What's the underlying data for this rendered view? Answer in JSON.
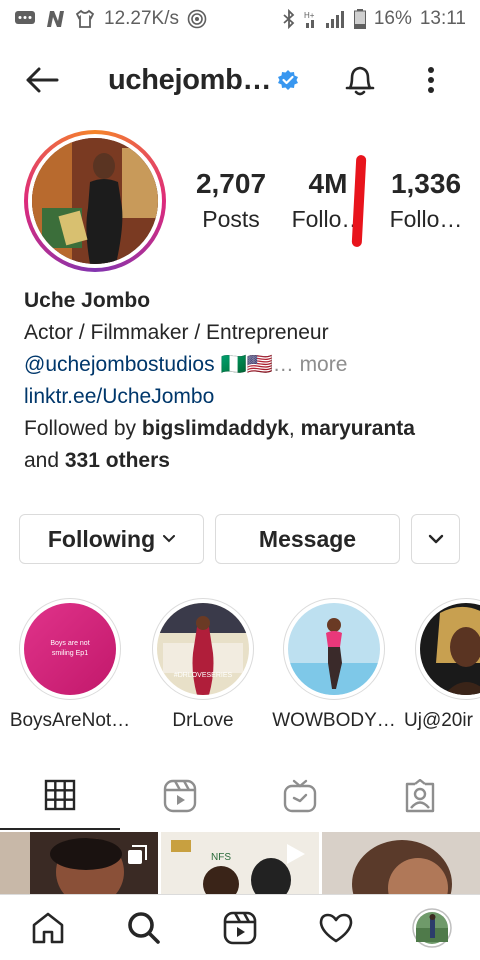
{
  "status_bar": {
    "speed": "12.27K/s",
    "battery": "16%",
    "time": "13:11"
  },
  "header": {
    "username": "uchejomb…",
    "verified": true
  },
  "stats": [
    {
      "number": "2,707",
      "label": "Posts"
    },
    {
      "number": "4M",
      "label": "Follo…"
    },
    {
      "number": "1,336",
      "label": "Follo…"
    }
  ],
  "bio": {
    "name": "Uche Jombo",
    "line1": "Actor / Filmmaker / Entrepreneur",
    "mention": "@uchejombostudios",
    "flags": "🇳🇬🇺🇸",
    "more": "… more",
    "link": "linktr.ee/UcheJombo",
    "followed_by_prefix": "Followed by ",
    "followed_user1": "bigslimdaddyk",
    "followed_sep": ", ",
    "followed_user2": "maryuranta",
    "followed_and": "and ",
    "followed_others": "331 others"
  },
  "actions": {
    "following": "Following",
    "message": "Message"
  },
  "highlights": [
    {
      "label": "BoysAreNot…",
      "cover_text": "Boys are not smiling Ep1"
    },
    {
      "label": "DrLove",
      "cover_text": "#DRLOVESERIES"
    },
    {
      "label": "WOWBODY…",
      "cover_text": ""
    },
    {
      "label": "Uj@20ir",
      "cover_text": ""
    }
  ],
  "tabs": [
    "grid-icon",
    "reels-icon",
    "igtv-icon",
    "tagged-icon"
  ],
  "colors": {
    "link": "#00376b",
    "verified": "#3897f0",
    "border": "#dbdbdb",
    "annotation": "#e8141c"
  }
}
